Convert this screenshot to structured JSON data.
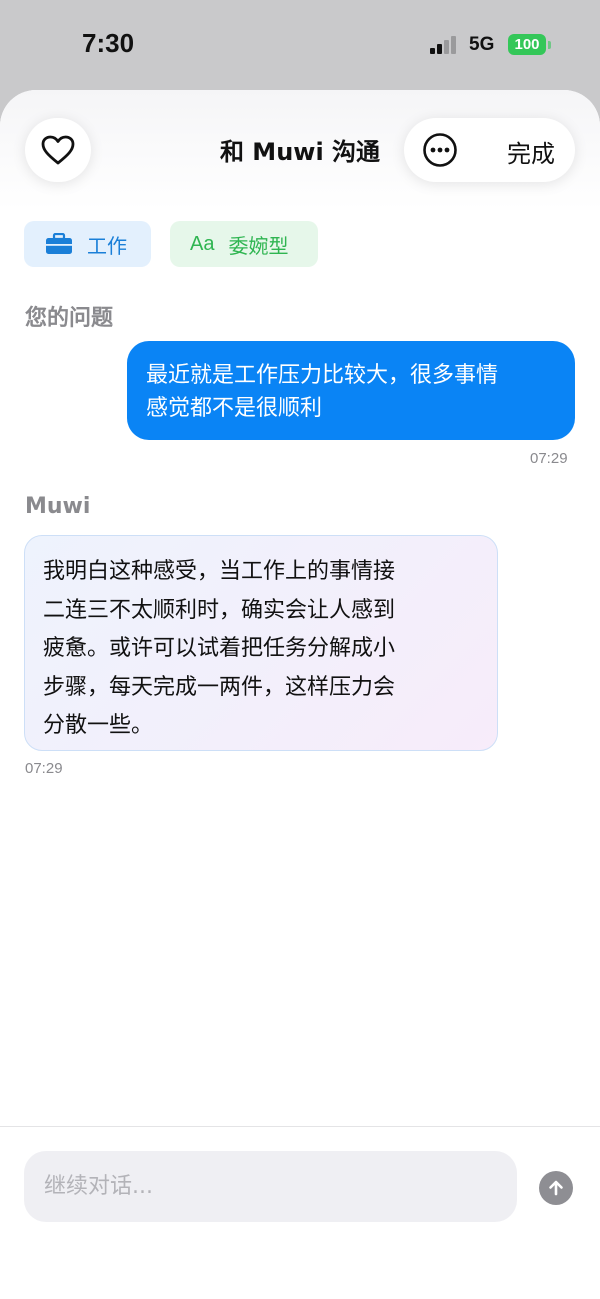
{
  "status_bar": {
    "time": "7:30",
    "network": "5G",
    "battery": "100"
  },
  "header": {
    "title": "和 Muwi 沟通",
    "done_label": "完成"
  },
  "tags": {
    "topic": "工作",
    "tone_icon": "Aa",
    "tone": "委婉型"
  },
  "conversation": {
    "user_section_label": "您的问题",
    "user_message_lines": [
      "最近就是工作压力比较大，很多事情",
      "感觉都不是很顺利"
    ],
    "user_time": "07:29",
    "bot_section_label": "Muwi",
    "bot_message_lines": [
      "我明白这种感受，当工作上的事情接",
      "二连三不太顺利时，确实会让人感到",
      "疲惫。或许可以试着把任务分解成小",
      "步骤，每天完成一两件，这样压力会",
      "分散一些。"
    ],
    "bot_time": "07:29"
  },
  "composer": {
    "placeholder": "继续对话..."
  },
  "colors": {
    "accent": "#0a84f5",
    "tag_work": "#1a7fd8",
    "tag_tone": "#2fb551",
    "battery": "#34c759"
  }
}
